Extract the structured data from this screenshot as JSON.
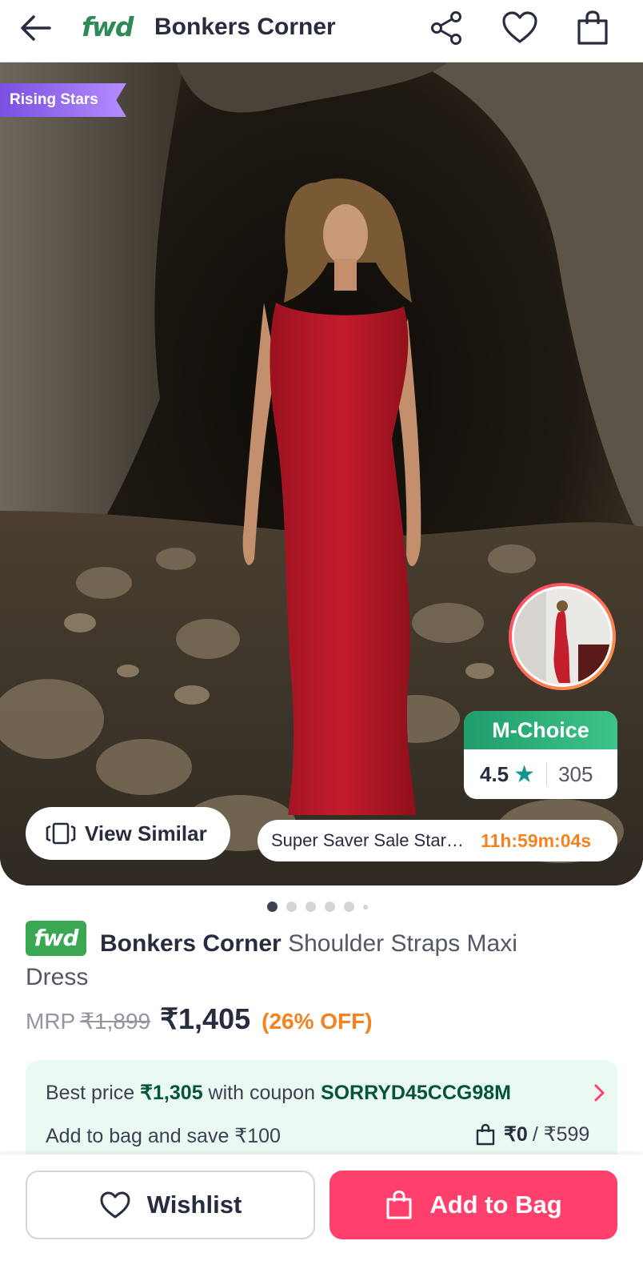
{
  "header": {
    "brand_logo": "fwd",
    "title": "Bonkers Corner",
    "icons": [
      "back-arrow-icon",
      "share-icon",
      "heart-icon",
      "bag-icon"
    ]
  },
  "hero": {
    "badge": "Rising Stars",
    "mchoice": {
      "label": "M-Choice",
      "rating": "4.5",
      "rating_count": "305"
    },
    "view_similar": "View Similar",
    "sale_text": "Super Saver Sale Star…",
    "sale_timer": "11h:59m:04s",
    "image_count": 6,
    "active_image_index": 0
  },
  "product": {
    "badge": "fwd",
    "brand": "Bonkers Corner",
    "name": "Shoulder Straps Maxi Dress",
    "mrp_label": "MRP",
    "mrp_value": "₹1,899",
    "price": "₹1,405",
    "discount": "(26% OFF)"
  },
  "coupon": {
    "prefix": "Best price",
    "best_price": "₹1,305",
    "middle": "with coupon",
    "code": "SORRYD45CCG98M",
    "save_text": "Add to bag and save ₹100",
    "bag_current": "₹0",
    "bag_target": "/ ₹599"
  },
  "actions": {
    "wishlist": "Wishlist",
    "add_to_bag": "Add to Bag"
  },
  "colors": {
    "accent": "#ff3f6c",
    "brand_green": "#3aa853",
    "discount_orange": "#f5821f",
    "coupon_bg": "#eafaf2"
  }
}
